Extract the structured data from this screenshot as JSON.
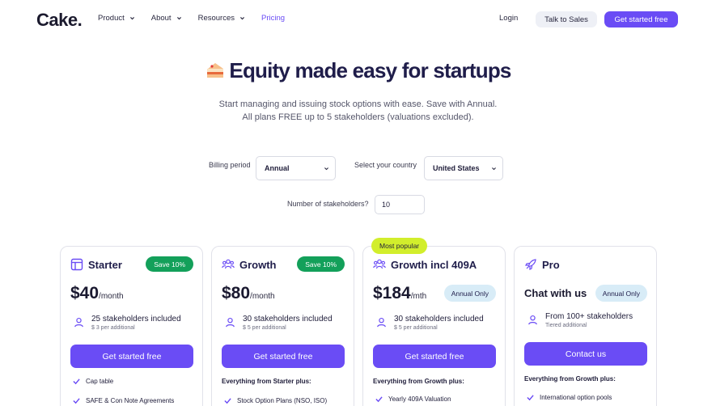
{
  "header": {
    "logo": "Cake.",
    "nav": [
      {
        "label": "Product",
        "has_dropdown": true
      },
      {
        "label": "About",
        "has_dropdown": true
      },
      {
        "label": "Resources",
        "has_dropdown": true
      },
      {
        "label": "Pricing",
        "has_dropdown": false
      }
    ],
    "login": "Login",
    "talk_to_sales": "Talk to Sales",
    "get_started": "Get started free"
  },
  "hero": {
    "title": "Equity made easy for startups",
    "subtitle_line1": "Start managing and issuing stock options with ease. Save with Annual.",
    "subtitle_line2": "All plans FREE up to 5 stakeholders (valuations excluded)."
  },
  "filters": {
    "billing_label": "Billing period",
    "billing_value": "Annual",
    "country_label": "Select your country",
    "country_value": "United States",
    "stakeholders_label": "Number of stakeholders?",
    "stakeholders_value": "10"
  },
  "colors": {
    "accent": "#6a4cf5",
    "save_badge": "#13a05a",
    "popular_badge": "#d2ee2c",
    "annual_badge": "#d8ecf7"
  },
  "plans": [
    {
      "name": "Starter",
      "icon": "layout-icon",
      "badge": "Save 10%",
      "price": "$40",
      "price_unit": "/month",
      "stakeholders": "25 stakeholders included",
      "stakeholders_sub": "$ 3 per additional",
      "button": "Get started free",
      "features_heading": "",
      "features": [
        "Cap table",
        "SAFE & Con Note Agreements"
      ]
    },
    {
      "name": "Growth",
      "icon": "team-icon",
      "badge": "Save 10%",
      "price": "$80",
      "price_unit": "/month",
      "stakeholders": "30 stakeholders included",
      "stakeholders_sub": "$ 5 per additional",
      "button": "Get started free",
      "features_heading": "Everything from Starter plus:",
      "features": [
        "Stock Option Plans (NSO, ISO)"
      ]
    },
    {
      "name": "Growth incl 409A",
      "icon": "team-icon",
      "top_badge": "Most popular",
      "badge": "Annual Only",
      "price": "$184",
      "price_unit": "/mth",
      "stakeholders": "30 stakeholders included",
      "stakeholders_sub": "$ 5 per additional",
      "button": "Get started free",
      "features_heading": "Everything from Growth plus:",
      "features": [
        "Yearly 409A Valuation"
      ]
    },
    {
      "name": "Pro",
      "icon": "rocket-icon",
      "badge": "Annual Only",
      "price": "Chat with us",
      "price_unit": "",
      "stakeholders": "From 100+ stakeholders",
      "stakeholders_sub": "Tiered additional",
      "button": "Contact us",
      "features_heading": "Everything from Growth plus:",
      "features": [
        "International option pools"
      ]
    }
  ]
}
